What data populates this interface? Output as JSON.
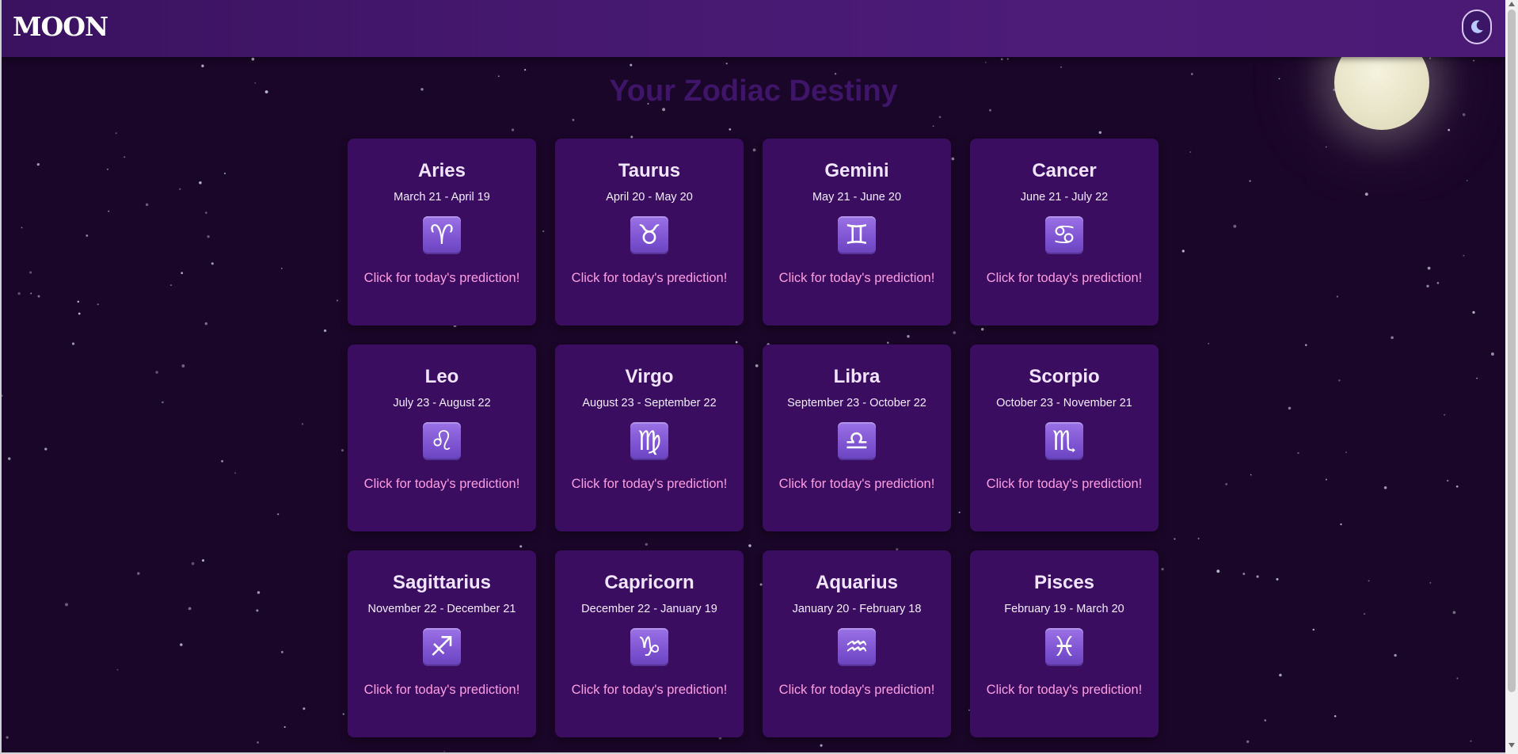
{
  "header": {
    "logo": "MOON",
    "theme_toggle_icon": "crescent-moon-icon"
  },
  "main": {
    "title": "Your Zodiac Destiny",
    "cards": [
      {
        "name": "Aries",
        "dates": "March 21 - April 19",
        "symbol": "♈",
        "cta": "Click for today's prediction!"
      },
      {
        "name": "Taurus",
        "dates": "April 20 - May 20",
        "symbol": "♉",
        "cta": "Click for today's prediction!"
      },
      {
        "name": "Gemini",
        "dates": "May 21 - June 20",
        "symbol": "♊",
        "cta": "Click for today's prediction!"
      },
      {
        "name": "Cancer",
        "dates": "June 21 - July 22",
        "symbol": "♋",
        "cta": "Click for today's prediction!"
      },
      {
        "name": "Leo",
        "dates": "July 23 - August 22",
        "symbol": "♌",
        "cta": "Click for today's prediction!"
      },
      {
        "name": "Virgo",
        "dates": "August 23 - September 22",
        "symbol": "♍",
        "cta": "Click for today's prediction!"
      },
      {
        "name": "Libra",
        "dates": "September 23 - October 22",
        "symbol": "♎",
        "cta": "Click for today's prediction!"
      },
      {
        "name": "Scorpio",
        "dates": "October 23 - November 21",
        "symbol": "♏",
        "cta": "Click for today's prediction!"
      },
      {
        "name": "Sagittarius",
        "dates": "November 22 - December 21",
        "symbol": "♐",
        "cta": "Click for today's prediction!"
      },
      {
        "name": "Capricorn",
        "dates": "December 22 - January 19",
        "symbol": "♑",
        "cta": "Click for today's prediction!"
      },
      {
        "name": "Aquarius",
        "dates": "January 20 - February 18",
        "symbol": "♒",
        "cta": "Click for today's prediction!"
      },
      {
        "name": "Pisces",
        "dates": "February 19 - March 20",
        "symbol": "♓",
        "cta": "Click for today's prediction!"
      }
    ]
  },
  "colors": {
    "background": "#1a0628",
    "header": "#45186e",
    "card": "#3a0d60",
    "card_name": "#f0e4ff",
    "cta": "#ff9ee0",
    "title": "#3e1568",
    "symbol_tile": "#7d53d1",
    "moon": "#ece8cf"
  }
}
